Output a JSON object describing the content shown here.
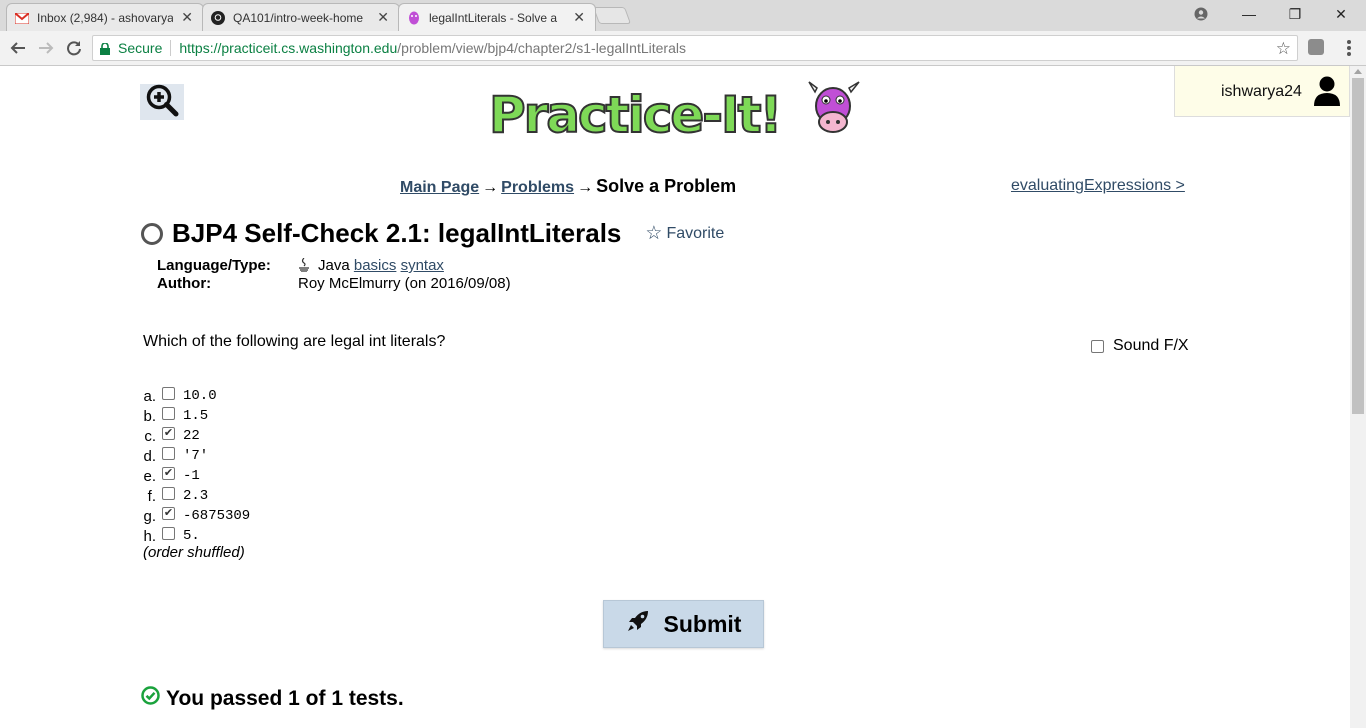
{
  "browser": {
    "tabs": [
      {
        "title": "Inbox (2,984) - ashovarya",
        "icon": "gmail-icon"
      },
      {
        "title": "QA101/intro-week-home",
        "icon": "github-icon"
      },
      {
        "title": "legalIntLiterals - Solve a",
        "icon": "cow-icon"
      }
    ],
    "close_glyph": "✕",
    "window_controls": {
      "minimize": "—",
      "restore": "❐",
      "close": "✕"
    },
    "address": {
      "secure_label": "Secure",
      "url_host": "https://practiceit.cs.washington.edu",
      "url_path": "/problem/view/bjp4/chapter2/s1-legalIntLiterals"
    }
  },
  "header": {
    "user": "ishwarya24",
    "logo_text": "Practice-It!"
  },
  "breadcrumb": {
    "main": "Main Page",
    "problems": "Problems",
    "current": "Solve a Problem",
    "arrow": "→"
  },
  "next_link": "evaluatingExpressions >",
  "problem": {
    "title": "BJP4 Self-Check 2.1: legalIntLiterals",
    "favorite": "Favorite",
    "language_label": "Language/Type:",
    "language": "Java",
    "tags": [
      "basics",
      "syntax"
    ],
    "author_label": "Author:",
    "author": "Roy McElmurry (on 2016/09/08)"
  },
  "question": "Which of the following are legal int literals?",
  "sound_label": "Sound F/X",
  "choices": [
    {
      "letter": "a.",
      "value": "10.0",
      "checked": false
    },
    {
      "letter": "b.",
      "value": "1.5",
      "checked": false
    },
    {
      "letter": "c.",
      "value": "22",
      "checked": true
    },
    {
      "letter": "d.",
      "value": "'7'",
      "checked": false
    },
    {
      "letter": "e.",
      "value": "-1",
      "checked": true
    },
    {
      "letter": "f.",
      "value": "2.3",
      "checked": false
    },
    {
      "letter": "g.",
      "value": "-6875309",
      "checked": true
    },
    {
      "letter": "h.",
      "value": "5.",
      "checked": false
    }
  ],
  "check_glyph": "✔",
  "order_note": "(order shuffled)",
  "submit_label": "Submit",
  "result": "You passed 1 of 1 tests.",
  "colors": {
    "link": "#304b66",
    "secure": "#0b8043",
    "pass": "#1aa23c",
    "logo_green": "#7ed957",
    "cow": "#c04fd6"
  }
}
